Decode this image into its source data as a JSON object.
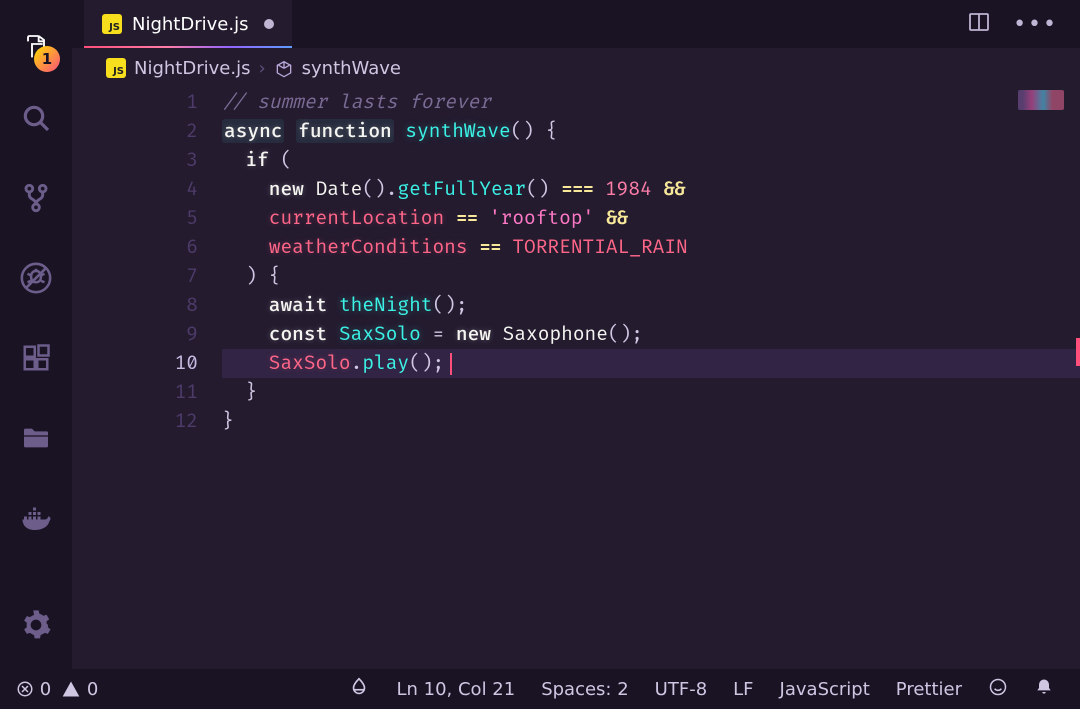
{
  "activity_badge": "1",
  "tab": {
    "filename": "NightDrive.js"
  },
  "breadcrumb": {
    "file": "NightDrive.js",
    "symbol": "synthWave"
  },
  "editor": {
    "line_numbers": [
      "1",
      "2",
      "3",
      "4",
      "5",
      "6",
      "7",
      "8",
      "9",
      "10",
      "11",
      "12"
    ],
    "active_line": 10,
    "tokens": {
      "comment": "// summer lasts forever",
      "kw_async": "async",
      "kw_function": "function",
      "fn_name": "synthWave",
      "paren_empty": "()",
      "brace_open": " {",
      "brace_close": "}",
      "kw_if": "if",
      "paren_open": " (",
      "kw_new": "new",
      "class_date": "Date",
      "method_getFullYear": "getFullYear",
      "op_eq3": "===",
      "num_1984": "1984",
      "op_and": "&&",
      "var_currentLocation": "currentLocation",
      "op_eq2": "==",
      "str_rooftop": "'rooftop'",
      "var_weatherConditions": "weatherConditions",
      "const_rain": "TORRENTIAL_RAIN",
      "paren_close_brace": ") {",
      "kw_await": "await",
      "fn_theNight": "theNight",
      "semicolon": ";",
      "kw_const": "const",
      "var_SaxSolo": "SaxSolo",
      "op_assign": " = ",
      "class_Saxophone": "Saxophone",
      "dot": ".",
      "method_play": "play"
    }
  },
  "status": {
    "errors": "0",
    "warnings": "0",
    "cursor": "Ln 10, Col 21",
    "spaces": "Spaces: 2",
    "encoding": "UTF-8",
    "eol": "LF",
    "language": "JavaScript",
    "formatter": "Prettier"
  }
}
